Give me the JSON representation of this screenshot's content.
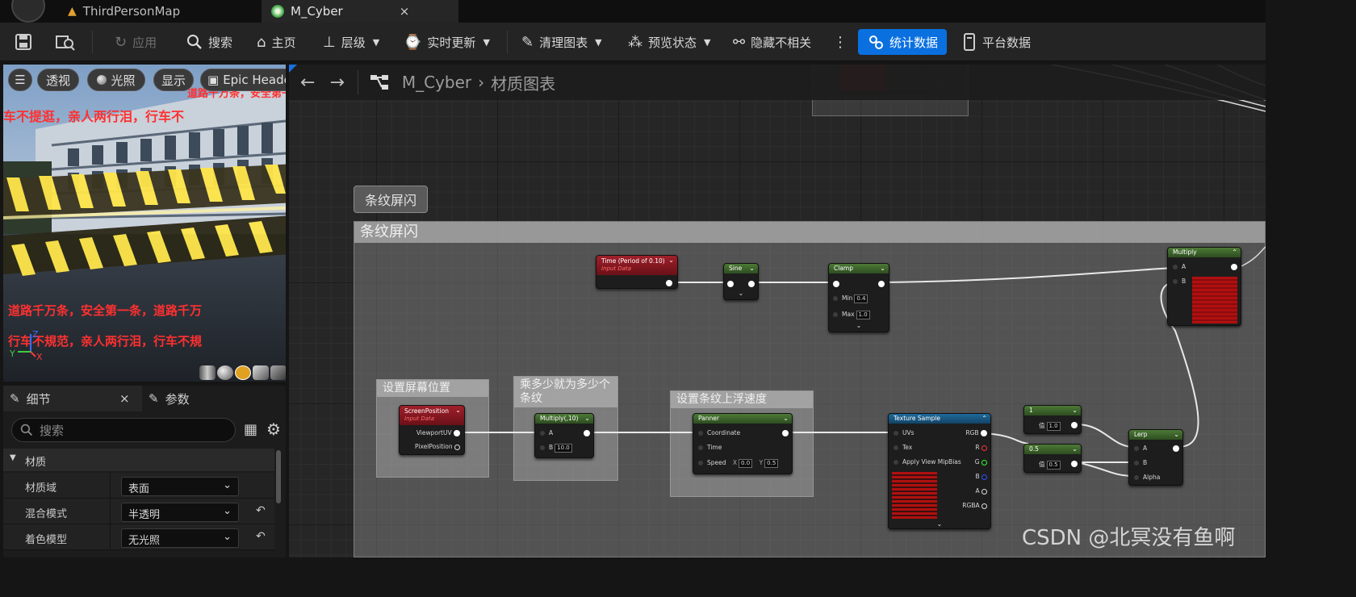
{
  "tabs": [
    {
      "label": "ThirdPersonMap",
      "active": false
    },
    {
      "label": "M_Cyber",
      "active": true
    }
  ],
  "tab_close": "×",
  "toolbar": {
    "apply": "应用",
    "search": "搜索",
    "home": "主页",
    "hierarchy": "层级",
    "live_update": "实时更新",
    "clean_graph": "清理图表",
    "preview_state": "预览状态",
    "hide_unrelated": "隐藏不相关",
    "stats": "统计数据",
    "platform_stats": "平台数据"
  },
  "viewport": {
    "buttons": {
      "perspective": "透视",
      "lit": "光照",
      "show": "显示",
      "preview_mesh": "Epic Heade"
    },
    "scene_text": {
      "line1": "车不提逛，亲人两行泪，行车不",
      "line2": "道路千万条，安全第一条，道路千万",
      "line3": "行车不規范，亲人两行泪，行车不規",
      "top": "道路千万条，安全第一条，道路千"
    },
    "axis": {
      "x": "X",
      "y": "Y",
      "z": "Z"
    }
  },
  "details": {
    "tab_details": "细节",
    "tab_params": "参数",
    "close": "×",
    "search_placeholder": "搜索",
    "section": "材质",
    "rows": [
      {
        "label": "材质域",
        "value": "表面",
        "resettable": false
      },
      {
        "label": "混合模式",
        "value": "半透明",
        "resettable": true
      },
      {
        "label": "着色模型",
        "value": "无光照",
        "resettable": true
      }
    ]
  },
  "graph": {
    "breadcrumb": {
      "asset": "M_Cyber",
      "separator": "›",
      "graph": "材质图表"
    },
    "bubble": "条纹屏闪",
    "comments": {
      "main": "条纹屏闪",
      "screen_pos": "设置屏幕位置",
      "stripes": "乘多少就为多少个条纹",
      "speed": "设置条纹上浮速度"
    },
    "nodes": {
      "time": {
        "title": "Time (Period of 0.10)",
        "sub": "Input Data"
      },
      "sine": {
        "title": "Sine"
      },
      "clamp": {
        "title": "Clamp",
        "min_label": "Min",
        "min": "0.4",
        "max_label": "Max",
        "max": "1.0"
      },
      "multiply_top": {
        "title": "Multiply",
        "a": "A",
        "b": "B"
      },
      "screenpos": {
        "title": "ScreenPosition",
        "sub": "Input Data",
        "out1": "ViewportUV",
        "out2": "PixelPosition"
      },
      "multiply_10": {
        "title": "Multiply(,10)",
        "a": "A",
        "b": "B",
        "b_val": "10.0"
      },
      "panner": {
        "title": "Panner",
        "coord": "Coordinate",
        "time": "Time",
        "speed": "Speed",
        "x_label": "X",
        "x": "0.0",
        "y_label": "Y",
        "y": "0.5"
      },
      "texture": {
        "title": "Texture Sample",
        "uvs": "UVs",
        "tex": "Tex",
        "mip": "Apply View MipBias",
        "rgb": "RGB",
        "r": "R",
        "g": "G",
        "b": "B",
        "a": "A",
        "rgba": "RGBA"
      },
      "const1": {
        "title": "1",
        "label": "值",
        "value": "1.0"
      },
      "const05": {
        "title": "0.5",
        "label": "值",
        "value": "0.5"
      },
      "lerp": {
        "title": "Lerp",
        "a": "A",
        "b": "B",
        "alpha": "Alpha"
      }
    }
  },
  "watermark": "CSDN @北冥没有鱼啊",
  "colors": {
    "accent_button": "#0a70e0",
    "input_node_header": "#a0202a",
    "math_node_header": "#4c7a36",
    "texture_node_header": "#1e6a9c",
    "stripe_red": "#a81818"
  },
  "icons": [
    "save-icon",
    "browse-icon",
    "apply-icon",
    "search-icon",
    "home-icon",
    "hierarchy-icon",
    "live-update-icon",
    "clean-graph-icon",
    "preview-state-icon",
    "hide-unrelated-icon",
    "more-icon",
    "stats-icon",
    "platform-icon",
    "back-arrow-icon",
    "forward-arrow-icon",
    "graph-icon",
    "pencil-icon",
    "grid-icon",
    "gear-icon",
    "reset-icon"
  ]
}
